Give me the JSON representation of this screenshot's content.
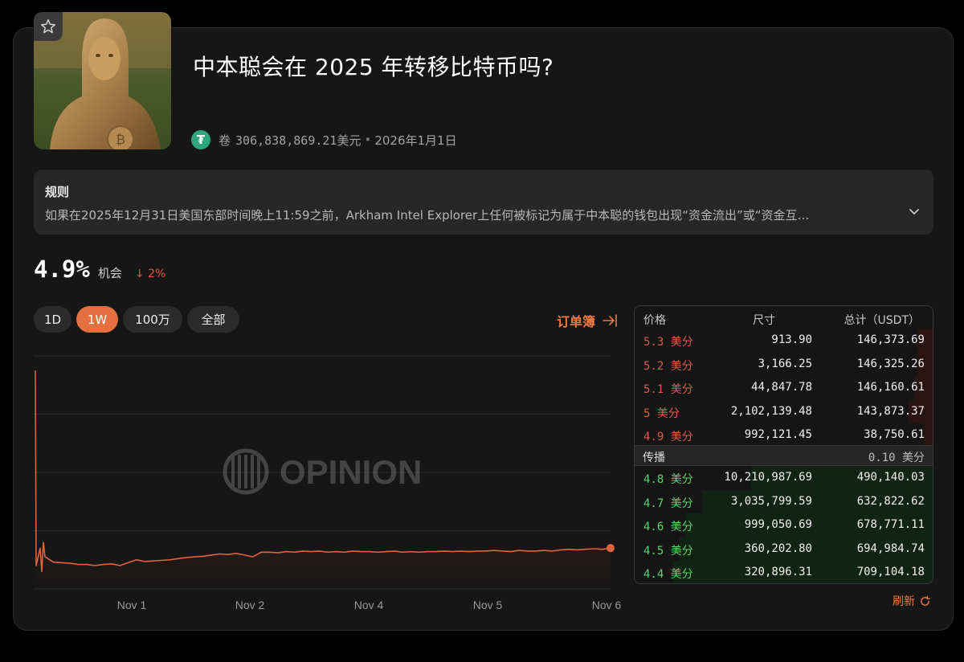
{
  "market": {
    "title": "中本聪会在 2025 年转移比特币吗?",
    "volume_label": "卷",
    "volume": "306,838,869.21美元",
    "separator": "•",
    "end_date": "2026年1月1日",
    "token_icon": "tether-icon"
  },
  "rules": {
    "title": "规则",
    "text": "如果在2025年12月31日美国东部时间晚上11:59之前，Arkham Intel Explorer上任何被标记为属于中本聪的钱包出现“资金流出”或“资金互…"
  },
  "probability": {
    "value": "4.9%",
    "label": "机会",
    "change": "↓ 2%",
    "change_color": "#e2583b"
  },
  "tabs": [
    {
      "label": "1D",
      "active": false
    },
    {
      "label": "1W",
      "active": true
    },
    {
      "label": "100万",
      "active": false
    },
    {
      "label": "全部",
      "active": false
    }
  ],
  "orderbook_link": "订单簿",
  "watermark": "OPINION",
  "chart_data": {
    "type": "line",
    "x_tick_labels": [
      "Nov 1",
      "Nov 2",
      "Nov 4",
      "Nov 5",
      "Nov 6"
    ],
    "ylim": [
      0,
      40
    ],
    "grid": true,
    "series_color": "#e0633a",
    "values": [
      37.5,
      4.0,
      7.0,
      3.0,
      8.0,
      5.5,
      4.6,
      4.5,
      4.4,
      4.2,
      4.2,
      4.0,
      4.2,
      4.3,
      4.0,
      4.5,
      5.0,
      4.7,
      4.8,
      4.9,
      5.0,
      5.2,
      5.4,
      5.5,
      5.6,
      5.8,
      6.0,
      5.9,
      6.1,
      5.8,
      5.5,
      6.3,
      6.3,
      6.2,
      6.4,
      6.3,
      6.5,
      6.4,
      6.5,
      6.3,
      6.4,
      6.3,
      6.5,
      6.4,
      6.4,
      6.3,
      6.4,
      6.5,
      6.3,
      6.4,
      6.3,
      6.4,
      6.4,
      6.5,
      6.4,
      6.5,
      6.4,
      6.5,
      6.5,
      6.6,
      6.5,
      6.4,
      6.6,
      6.5,
      6.5,
      6.6,
      6.5,
      6.7,
      6.8,
      6.7,
      6.8,
      6.9,
      6.8,
      7.0
    ]
  },
  "orderbook": {
    "headers": {
      "price": "价格",
      "size": "尺寸",
      "total": "总计（USDT）"
    },
    "price_unit": "美分",
    "asks": [
      {
        "price": "5.3",
        "size": "913.90",
        "total": "146,373.69",
        "depth": 0.05
      },
      {
        "price": "5.2",
        "size": "3,166.25",
        "total": "146,325.26",
        "depth": 0.05
      },
      {
        "price": "5.1",
        "size": "44,847.78",
        "total": "146,160.61",
        "depth": 0.06
      },
      {
        "price": "5",
        "size": "2,102,139.48",
        "total": "143,873.37",
        "depth": 0.08
      },
      {
        "price": "4.9",
        "size": "992,121.45",
        "total": "38,750.61",
        "depth": 0.03
      }
    ],
    "spread": {
      "label": "传播",
      "value": "0.10"
    },
    "bids": [
      {
        "price": "4.8",
        "size": "10,210,987.69",
        "total": "490,140.03",
        "depth": 0.61
      },
      {
        "price": "4.7",
        "size": "3,035,799.59",
        "total": "632,822.62",
        "depth": 0.77
      },
      {
        "price": "4.6",
        "size": "999,050.69",
        "total": "678,771.11",
        "depth": 0.83
      },
      {
        "price": "4.5",
        "size": "360,202.80",
        "total": "694,984.74",
        "depth": 0.85
      },
      {
        "price": "4.4",
        "size": "320,896.31",
        "total": "709,104.18",
        "depth": 0.87
      }
    ]
  },
  "refresh_label": "刷新"
}
